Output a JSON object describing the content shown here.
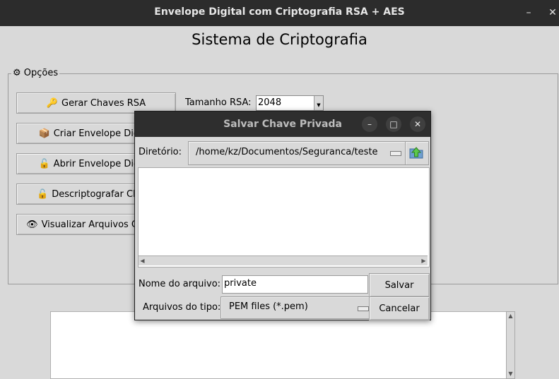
{
  "window": {
    "title": "Envelope Digital com Criptografia RSA + AES",
    "minimize_glyph": "–",
    "close_glyph": "✕"
  },
  "page_title": "Sistema de Criptografia",
  "options_group": {
    "icon": "gear-icon",
    "icon_glyph": "⚙",
    "label": "Opções",
    "buttons": [
      {
        "icon": "key-icon",
        "glyph": "🔑",
        "label": "Gerar Chaves RSA"
      },
      {
        "icon": "package-icon",
        "glyph": "📦",
        "label": "Criar Envelope Digital"
      },
      {
        "icon": "open-lock-icon",
        "glyph": "🔓",
        "label": "Abrir Envelope Digital"
      },
      {
        "icon": "unlock-icon",
        "glyph": "🔓",
        "label": "Descriptografar Chave"
      },
      {
        "icon": "eye-icon",
        "glyph": "👁",
        "label": "Visualizar Arquivos Criados"
      }
    ],
    "rsa_size_label": "Tamanho RSA:",
    "rsa_size_value": "2048"
  },
  "dialog": {
    "title": "Salvar Chave Privada",
    "minimize_glyph": "–",
    "maximize_glyph": "□",
    "close_glyph": "✕",
    "directory_label": "Diretório:",
    "directory_value": "/home/kz/Documentos/Seguranca/teste",
    "filename_label": "Nome do arquivo:",
    "filename_value": "private",
    "filetype_label": "Arquivos do tipo:",
    "filetype_value": "PEM files (*.pem)",
    "save_label": "Salvar",
    "cancel_label": "Cancelar"
  }
}
